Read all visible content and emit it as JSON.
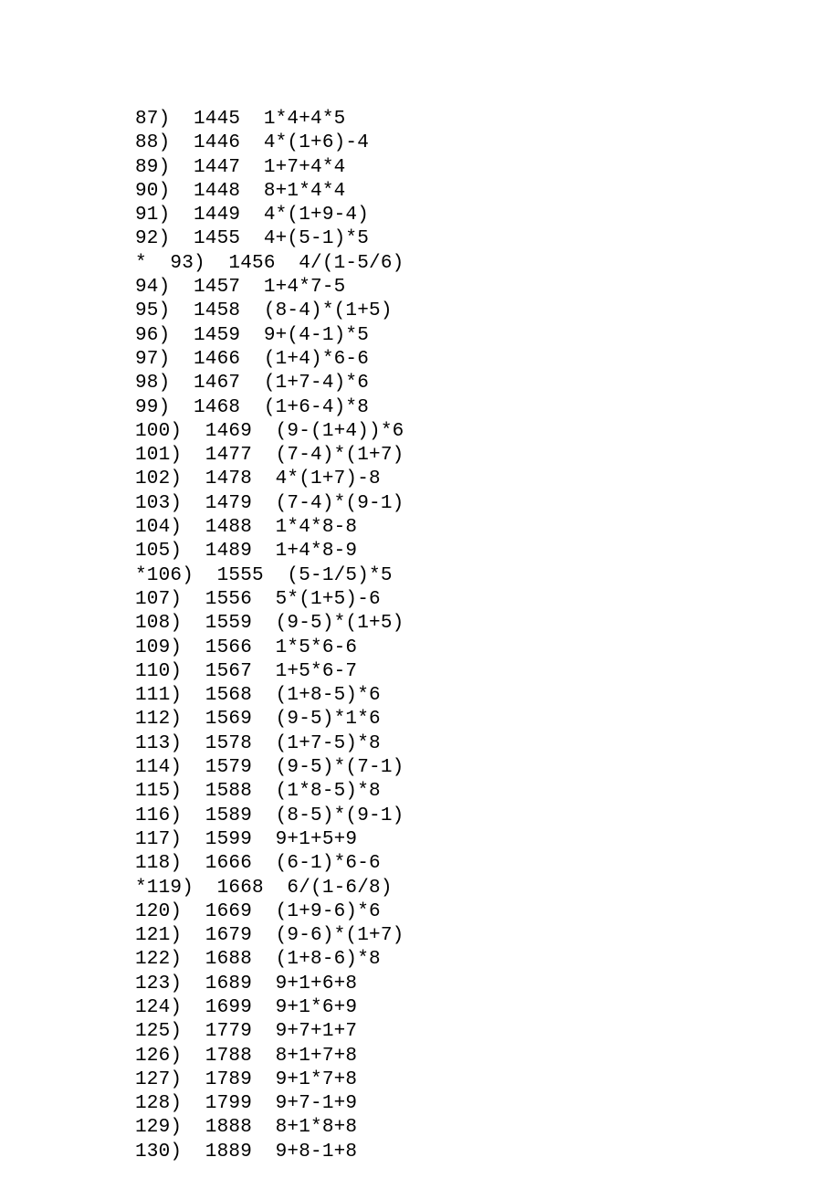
{
  "rows": [
    {
      "star": false,
      "num": "87",
      "digits": "1445",
      "expr": "1*4+4*5"
    },
    {
      "star": false,
      "num": "88",
      "digits": "1446",
      "expr": "4*(1+6)-4"
    },
    {
      "star": false,
      "num": "89",
      "digits": "1447",
      "expr": "1+7+4*4"
    },
    {
      "star": false,
      "num": "90",
      "digits": "1448",
      "expr": "8+1*4*4"
    },
    {
      "star": false,
      "num": "91",
      "digits": "1449",
      "expr": "4*(1+9-4)"
    },
    {
      "star": false,
      "num": "92",
      "digits": "1455",
      "expr": "4+(5-1)*5"
    },
    {
      "star": true,
      "num": "93",
      "digits": "1456",
      "expr": "4/(1-5/6)"
    },
    {
      "star": false,
      "num": "94",
      "digits": "1457",
      "expr": "1+4*7-5"
    },
    {
      "star": false,
      "num": "95",
      "digits": "1458",
      "expr": "(8-4)*(1+5)"
    },
    {
      "star": false,
      "num": "96",
      "digits": "1459",
      "expr": "9+(4-1)*5"
    },
    {
      "star": false,
      "num": "97",
      "digits": "1466",
      "expr": "(1+4)*6-6"
    },
    {
      "star": false,
      "num": "98",
      "digits": "1467",
      "expr": "(1+7-4)*6"
    },
    {
      "star": false,
      "num": "99",
      "digits": "1468",
      "expr": "(1+6-4)*8"
    },
    {
      "star": false,
      "num": "100",
      "digits": "1469",
      "expr": "(9-(1+4))*6"
    },
    {
      "star": false,
      "num": "101",
      "digits": "1477",
      "expr": "(7-4)*(1+7)"
    },
    {
      "star": false,
      "num": "102",
      "digits": "1478",
      "expr": "4*(1+7)-8"
    },
    {
      "star": false,
      "num": "103",
      "digits": "1479",
      "expr": "(7-4)*(9-1)"
    },
    {
      "star": false,
      "num": "104",
      "digits": "1488",
      "expr": "1*4*8-8"
    },
    {
      "star": false,
      "num": "105",
      "digits": "1489",
      "expr": "1+4*8-9"
    },
    {
      "star": true,
      "num": "106",
      "digits": "1555",
      "expr": "(5-1/5)*5"
    },
    {
      "star": false,
      "num": "107",
      "digits": "1556",
      "expr": "5*(1+5)-6"
    },
    {
      "star": false,
      "num": "108",
      "digits": "1559",
      "expr": "(9-5)*(1+5)"
    },
    {
      "star": false,
      "num": "109",
      "digits": "1566",
      "expr": "1*5*6-6"
    },
    {
      "star": false,
      "num": "110",
      "digits": "1567",
      "expr": "1+5*6-7"
    },
    {
      "star": false,
      "num": "111",
      "digits": "1568",
      "expr": "(1+8-5)*6"
    },
    {
      "star": false,
      "num": "112",
      "digits": "1569",
      "expr": "(9-5)*1*6"
    },
    {
      "star": false,
      "num": "113",
      "digits": "1578",
      "expr": "(1+7-5)*8"
    },
    {
      "star": false,
      "num": "114",
      "digits": "1579",
      "expr": "(9-5)*(7-1)"
    },
    {
      "star": false,
      "num": "115",
      "digits": "1588",
      "expr": "(1*8-5)*8"
    },
    {
      "star": false,
      "num": "116",
      "digits": "1589",
      "expr": "(8-5)*(9-1)"
    },
    {
      "star": false,
      "num": "117",
      "digits": "1599",
      "expr": "9+1+5+9"
    },
    {
      "star": false,
      "num": "118",
      "digits": "1666",
      "expr": "(6-1)*6-6"
    },
    {
      "star": true,
      "num": "119",
      "digits": "1668",
      "expr": "6/(1-6/8)"
    },
    {
      "star": false,
      "num": "120",
      "digits": "1669",
      "expr": "(1+9-6)*6"
    },
    {
      "star": false,
      "num": "121",
      "digits": "1679",
      "expr": "(9-6)*(1+7)"
    },
    {
      "star": false,
      "num": "122",
      "digits": "1688",
      "expr": "(1+8-6)*8"
    },
    {
      "star": false,
      "num": "123",
      "digits": "1689",
      "expr": "9+1+6+8"
    },
    {
      "star": false,
      "num": "124",
      "digits": "1699",
      "expr": "9+1*6+9"
    },
    {
      "star": false,
      "num": "125",
      "digits": "1779",
      "expr": "9+7+1+7"
    },
    {
      "star": false,
      "num": "126",
      "digits": "1788",
      "expr": "8+1+7+8"
    },
    {
      "star": false,
      "num": "127",
      "digits": "1789",
      "expr": "9+1*7+8"
    },
    {
      "star": false,
      "num": "128",
      "digits": "1799",
      "expr": "9+7-1+9"
    },
    {
      "star": false,
      "num": "129",
      "digits": "1888",
      "expr": "8+1*8+8"
    },
    {
      "star": false,
      "num": "130",
      "digits": "1889",
      "expr": "9+8-1+8"
    }
  ]
}
